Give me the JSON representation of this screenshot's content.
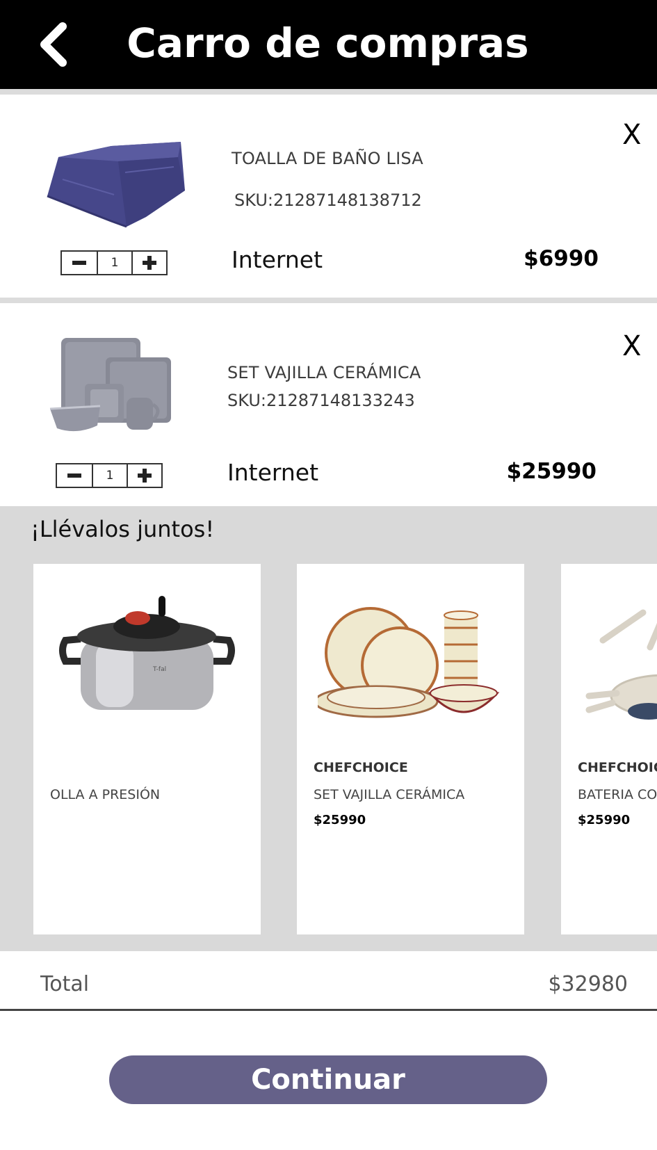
{
  "header": {
    "title": "Carro de compras",
    "back_icon": "chevron-left-icon"
  },
  "cart": {
    "items": [
      {
        "name": "TOALLA DE BAÑO LISA",
        "sku": "SKU:21287148138712",
        "channel": "Internet",
        "price": "$6990",
        "quantity": "1",
        "remove": "X"
      },
      {
        "name": "SET VAJILLA CERÁMICA",
        "sku": "SKU:21287148133243",
        "channel": "Internet",
        "price": "$25990",
        "quantity": "1",
        "remove": "X"
      }
    ]
  },
  "bundle": {
    "title": "¡Llévalos juntos!",
    "products": [
      {
        "brand": "",
        "name": "OLLA A PRESIÓN",
        "price": ""
      },
      {
        "brand": "CHEFCHOICE",
        "name": "SET VAJILLA CERÁMICA",
        "price": "$25990"
      },
      {
        "brand": "CHEFCHOICE",
        "name": "BATERIA COCINA",
        "price": "$25990"
      }
    ]
  },
  "summary": {
    "total_label": "Total",
    "total_value": "$32980"
  },
  "actions": {
    "continue_label": "Continuar"
  },
  "colors": {
    "header_bg": "#000000",
    "accent": "#656189",
    "bundle_bg": "#d9d9d9",
    "towel": "#4b4c8c"
  }
}
